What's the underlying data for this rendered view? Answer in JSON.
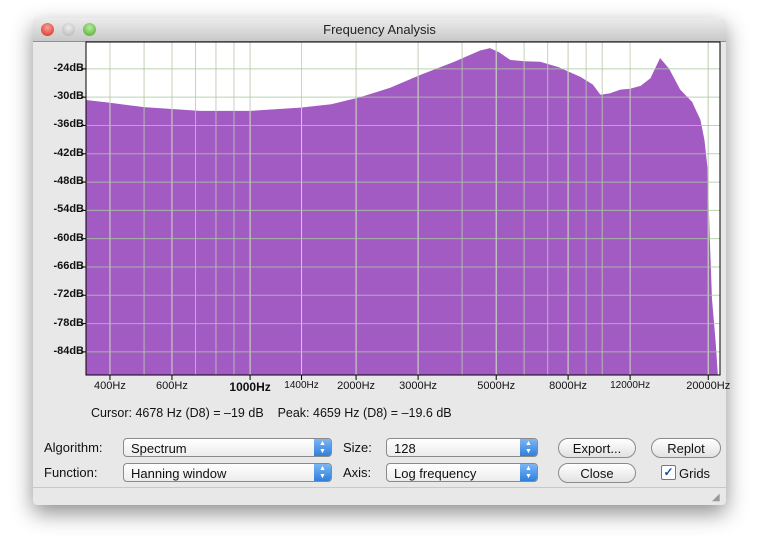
{
  "window": {
    "title": "Frequency Analysis"
  },
  "chart_data": {
    "type": "area",
    "title": "",
    "xscale": "log",
    "xlim": [
      342,
      21600
    ],
    "ylim": [
      -88.9,
      -18.3
    ],
    "x_ticks": [
      "400Hz",
      "600Hz",
      "1000Hz",
      "1400Hz",
      "2000Hz",
      "3000Hz",
      "5000Hz",
      "8000Hz",
      "12000Hz",
      "20000Hz"
    ],
    "x_tick_values": [
      400,
      600,
      1000,
      1400,
      2000,
      3000,
      5000,
      8000,
      12000,
      20000
    ],
    "y_ticks": [
      "-24dB",
      "-30dB",
      "-36dB",
      "-42dB",
      "-48dB",
      "-54dB",
      "-60dB",
      "-66dB",
      "-72dB",
      "-78dB",
      "-84dB"
    ],
    "y_tick_values": [
      -24,
      -30,
      -36,
      -42,
      -48,
      -54,
      -60,
      -66,
      -72,
      -78,
      -84
    ],
    "grid": true,
    "series": [
      {
        "name": "spectrum",
        "color": "#a35bc4",
        "x": [
          342,
          400,
          500,
          720,
          1000,
          1390,
          1700,
          2050,
          2500,
          3040,
          3800,
          4500,
          4800,
          5100,
          5480,
          6000,
          6660,
          7500,
          8670,
          9400,
          9880,
          10500,
          11260,
          12000,
          12850,
          13700,
          14600,
          15500,
          16650,
          18000,
          19000,
          19500,
          19900,
          20200,
          20500,
          21000,
          21300
        ],
        "y": [
          -30.6,
          -31.2,
          -32.1,
          -32.9,
          -32.9,
          -32.2,
          -31.5,
          -30,
          -28,
          -25.3,
          -22.5,
          -20.1,
          -19.6,
          -20.5,
          -22.1,
          -22.4,
          -22.5,
          -23.6,
          -25.7,
          -27.3,
          -29.5,
          -29.2,
          -28.4,
          -28.2,
          -27.6,
          -26,
          -21.7,
          -24,
          -28.4,
          -31,
          -34.8,
          -39,
          -45,
          -60,
          -72.8,
          -82,
          -89
        ]
      }
    ]
  },
  "status": {
    "cursor": "Cursor: 4678 Hz (D8) = –19 dB",
    "peak": "Peak: 4659 Hz (D8) = –19.6 dB"
  },
  "controls": {
    "algorithm_label": "Algorithm:",
    "algorithm_value": "Spectrum",
    "function_label": "Function:",
    "function_value": "Hanning window",
    "size_label": "Size:",
    "size_value": "128",
    "axis_label": "Axis:",
    "axis_value": "Log frequency",
    "export": "Export...",
    "replot": "Replot",
    "close": "Close",
    "grids": "Grids",
    "grids_checked": true
  }
}
